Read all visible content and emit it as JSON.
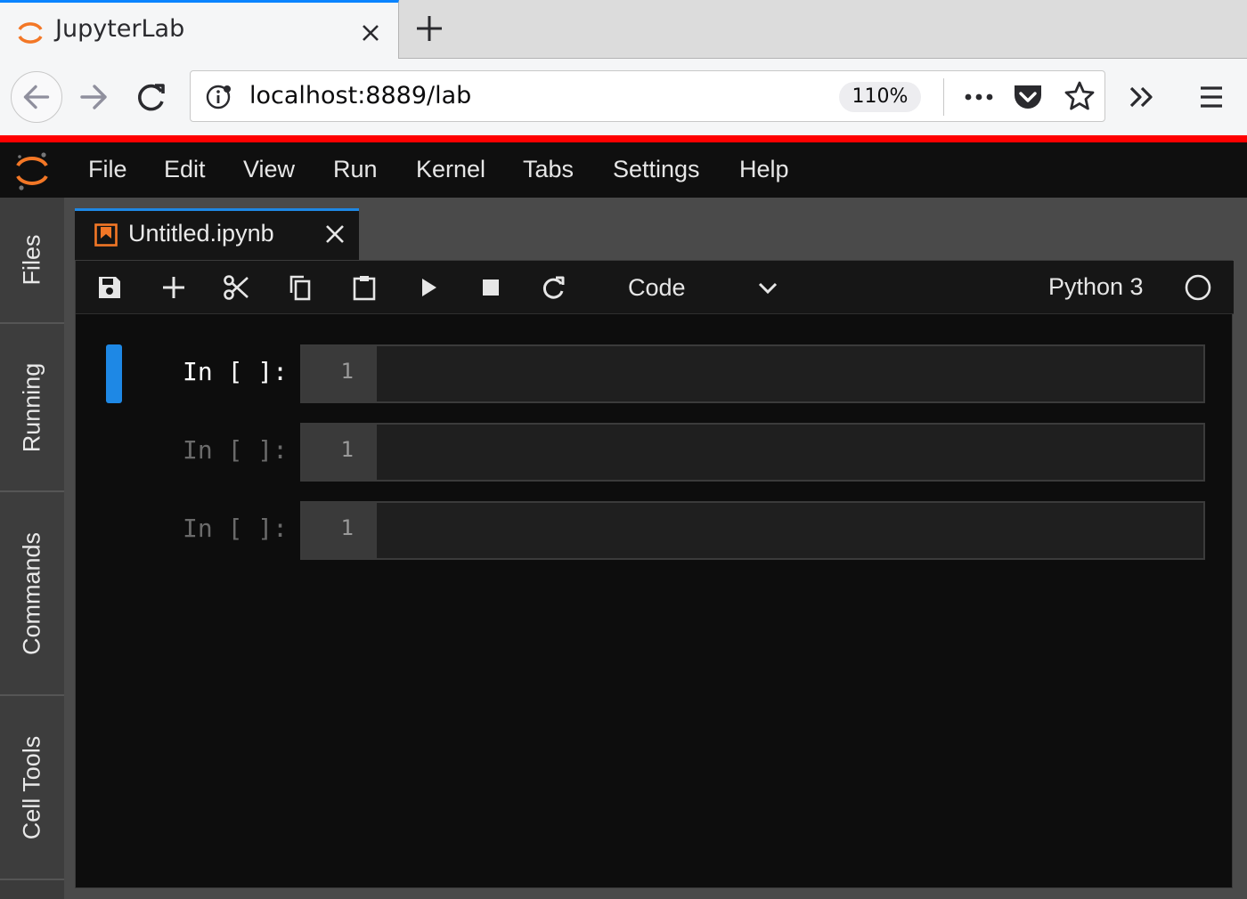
{
  "browser": {
    "tab_title": "JupyterLab",
    "url": "localhost:8889/lab",
    "zoom": "110%",
    "accent_color": "#0a84ff"
  },
  "jupyter": {
    "menu": [
      "File",
      "Edit",
      "View",
      "Run",
      "Kernel",
      "Tabs",
      "Settings",
      "Help"
    ],
    "sidebar_tabs": [
      "Files",
      "Running",
      "Commands",
      "Cell Tools"
    ],
    "document_tab": "Untitled.ipynb",
    "toolbar": {
      "cell_type": "Code",
      "kernel": "Python 3",
      "buttons": [
        "save-icon",
        "add-cell-icon",
        "cut-icon",
        "copy-icon",
        "paste-icon",
        "run-icon",
        "stop-icon",
        "restart-icon"
      ]
    },
    "cells": [
      {
        "prompt": "In [ ]:",
        "line_number": "1",
        "active": true
      },
      {
        "prompt": "In [ ]:",
        "line_number": "1",
        "active": false
      },
      {
        "prompt": "In [ ]:",
        "line_number": "1",
        "active": false
      }
    ],
    "colors": {
      "brand_orange": "#f37726",
      "active_cell": "#1e88e5",
      "top_stripe": "#ff0000"
    }
  }
}
